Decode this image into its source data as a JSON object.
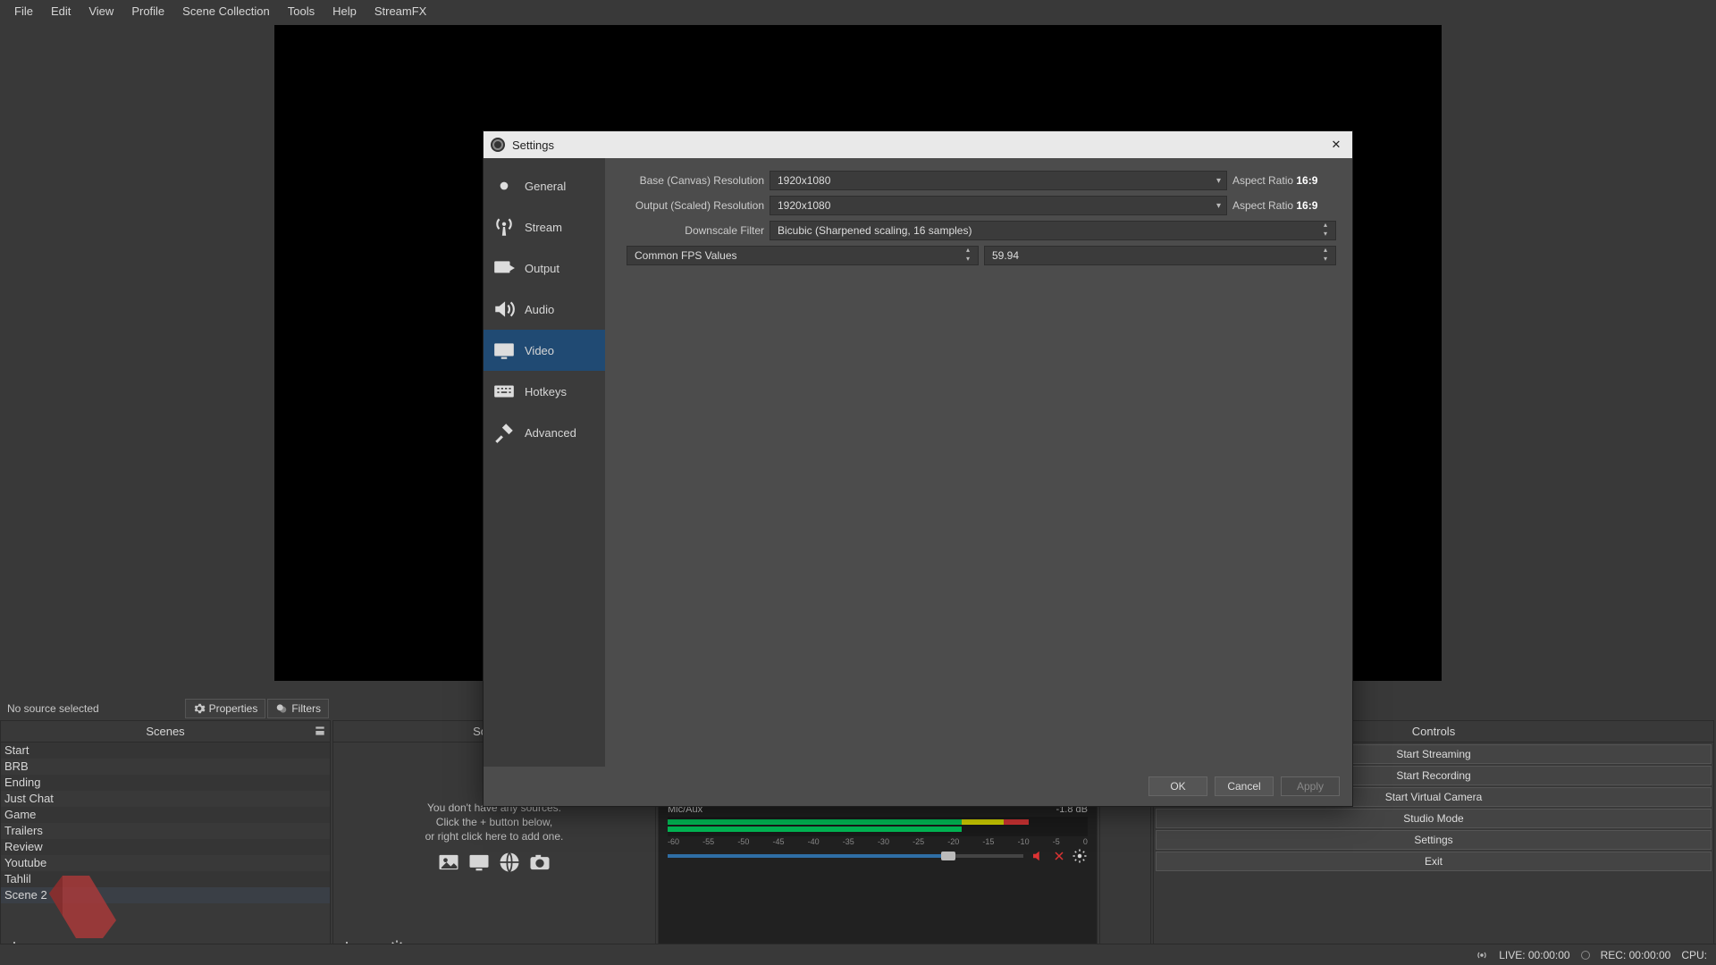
{
  "menubar": [
    "File",
    "Edit",
    "View",
    "Profile",
    "Scene Collection",
    "Tools",
    "Help",
    "StreamFX"
  ],
  "source_toolbar": {
    "no_selection": "No source selected",
    "properties_label": "Properties",
    "filters_label": "Filters"
  },
  "docks": {
    "scenes_title": "Scenes",
    "sources_title": "Sources",
    "controls_title": "Controls"
  },
  "scenes": [
    "Start",
    "BRB",
    "Ending",
    "Just Chat",
    "Game",
    "Trailers",
    "Review",
    "Youtube",
    "Tahlil",
    "Scene 2"
  ],
  "sources_empty": {
    "l1": "You don't have any sources.",
    "l2": "Click the + button below,",
    "l3": "or right click here to add one."
  },
  "mixer": {
    "chan2_name": "Mic/Aux",
    "chan2_db": "-1.8 dB",
    "ticks": [
      "-60",
      "-55",
      "-50",
      "-45",
      "-40",
      "-35",
      "-30",
      "-25",
      "-20",
      "-15",
      "-10",
      "-5",
      "0"
    ]
  },
  "controls": [
    "Start Streaming",
    "Start Recording",
    "Start Virtual Camera",
    "Studio Mode",
    "Settings",
    "Exit"
  ],
  "status": {
    "live": "LIVE: 00:00:00",
    "rec": "REC: 00:00:00",
    "cpu": "CPU:"
  },
  "dialog": {
    "title": "Settings",
    "cats": [
      "General",
      "Stream",
      "Output",
      "Audio",
      "Video",
      "Hotkeys",
      "Advanced"
    ],
    "labels": {
      "base": "Base (Canvas) Resolution",
      "output": "Output (Scaled) Resolution",
      "filter": "Downscale Filter",
      "fps": "Common FPS Values",
      "aspect_prefix": "Aspect Ratio ",
      "aspect_value": "16:9"
    },
    "values": {
      "base": "1920x1080",
      "output": "1920x1080",
      "filter": "Bicubic (Sharpened scaling, 16 samples)",
      "fps": "59.94"
    },
    "buttons": {
      "ok": "OK",
      "cancel": "Cancel",
      "apply": "Apply"
    }
  }
}
